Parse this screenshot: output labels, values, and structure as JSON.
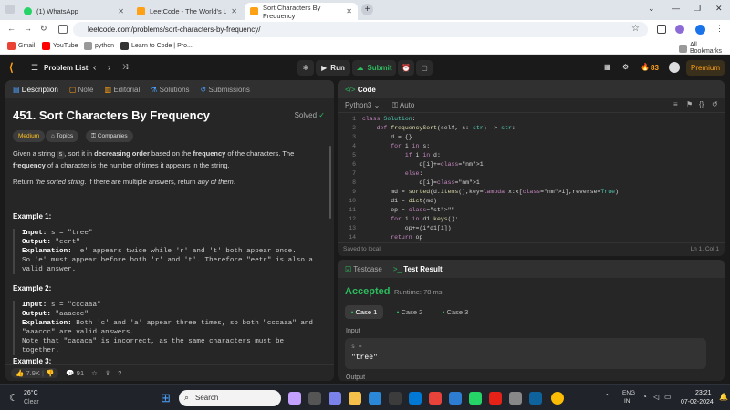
{
  "browser": {
    "tabs": [
      {
        "label": "(1) WhatsApp",
        "icon": "whatsapp-icon"
      },
      {
        "label": "LeetCode - The World's Leadin",
        "icon": "leetcode-icon"
      },
      {
        "label": "Sort Characters By Frequency",
        "icon": "leetcode-icon",
        "active": true
      }
    ],
    "url": "leetcode.com/problems/sort-characters-by-frequency/",
    "bookmarks": [
      "Gmail",
      "YouTube",
      "python",
      "Learn to Code | Pro..."
    ],
    "all_bookmarks": "All Bookmarks",
    "window_controls": [
      "⌄",
      "—",
      "❐",
      "✕"
    ]
  },
  "lc_nav": {
    "problem_list": "Problem List",
    "run": "Run",
    "submit": "Submit",
    "streak": "83",
    "premium": "Premium"
  },
  "left_tabs": [
    "Description",
    "Note",
    "Editorial",
    "Solutions",
    "Submissions"
  ],
  "problem": {
    "title": "451. Sort Characters By Frequency",
    "solved": "Solved",
    "difficulty": "Medium",
    "chips": [
      "Topics",
      "Companies"
    ],
    "desc_1a": "Given a string ",
    "desc_1s": "s",
    "desc_1b": ", sort it in ",
    "desc_1c": "decreasing order",
    "desc_1d": " based on the ",
    "desc_1e": "frequency",
    "desc_1f": " of the characters. The ",
    "desc_1g": "frequency",
    "desc_1h": " of a character is the number of times it appears in the string.",
    "desc_2a": "Return ",
    "desc_2b": "the sorted string",
    "desc_2c": ". If there are multiple answers, return ",
    "desc_2d": "any of them",
    "desc_2e": ".",
    "examples": [
      {
        "head": "Example 1:",
        "input_label": "Input:",
        "input": " s = \"tree\"",
        "output_label": "Output:",
        "output": " \"eert\"",
        "expl_label": "Explanation:",
        "expl": " 'e' appears twice while 'r' and 't' both appear once.",
        "expl2": "So 'e' must appear before both 'r' and 't'. Therefore \"eetr\" is also a",
        "expl3": "valid answer."
      },
      {
        "head": "Example 2:",
        "input_label": "Input:",
        "input": " s = \"cccaaa\"",
        "output_label": "Output:",
        "output": " \"aaaccc\"",
        "expl_label": "Explanation:",
        "expl": " Both 'c' and 'a' appear three times, so both \"cccaaa\" and",
        "expl2": "\"aaaccc\" are valid answers.",
        "expl3": "Note that \"cacaca\" is incorrect, as the same characters must be together."
      },
      {
        "head": "Example 3:"
      }
    ],
    "likes": "7.9K",
    "comments": "91"
  },
  "code": {
    "header": "Code",
    "language": "Python3",
    "auto": "Auto",
    "lines": [
      "class Solution:",
      "    def frequencySort(self, s: str) -> str:",
      "        d = {}",
      "        for i in s:",
      "            if i in d:",
      "                d[i]+=1",
      "            else:",
      "                d[i]=1",
      "        md = sorted(d.items(),key=lambda x:x[1],reverse=True)",
      "        d1 = dict(md)",
      "        op = \"\"",
      "        for i in d1.keys():",
      "            op+=(i*d1[i])",
      "        return op"
    ],
    "status": "Saved to local",
    "cursor": "Ln 1, Col 1"
  },
  "test": {
    "tab_testcase": "Testcase",
    "tab_result": "Test Result",
    "verdict": "Accepted",
    "runtime": "Runtime: 78 ms",
    "cases": [
      "Case 1",
      "Case 2",
      "Case 3"
    ],
    "input_label": "Input",
    "var": "s =",
    "value": "\"tree\"",
    "output_label": "Output"
  },
  "taskbar": {
    "temp": "26°C",
    "weather": "Clear",
    "search": "Search",
    "lang1": "ENG",
    "lang2": "IN",
    "time": "23:21",
    "date": "07-02-2024"
  },
  "colors": {
    "accent": "#ffa116",
    "green": "#2cbb5d",
    "run_bg": "#3a3a3a"
  }
}
